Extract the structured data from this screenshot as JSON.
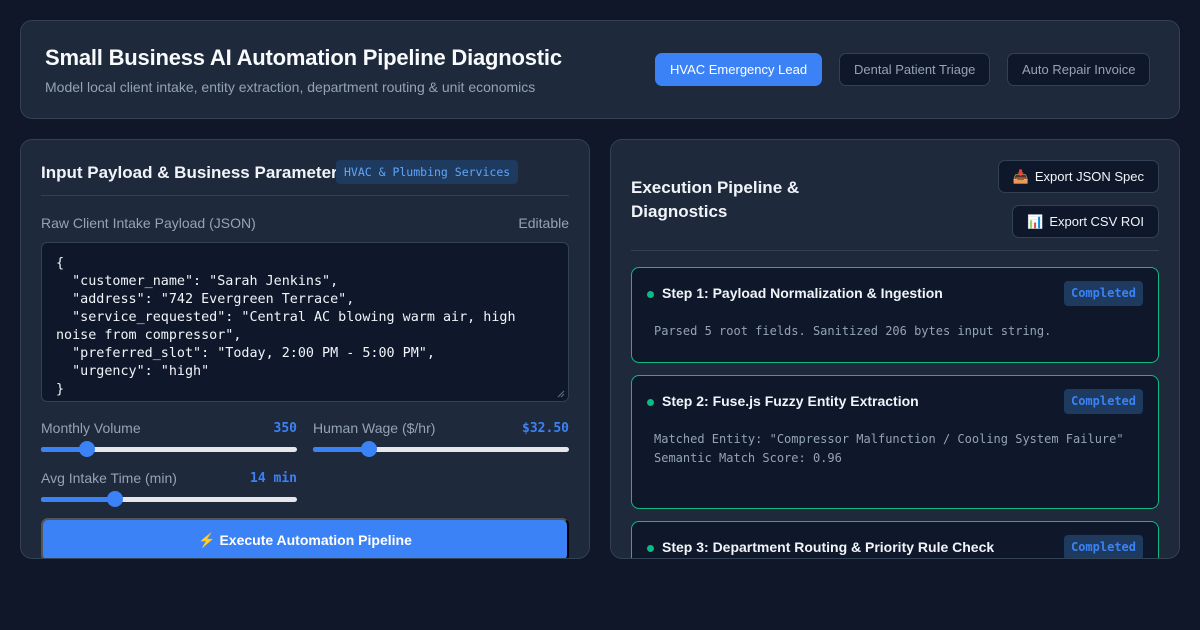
{
  "header": {
    "title": "Small Business AI Automation Pipeline Diagnostic",
    "subtitle": "Model local client intake, entity extraction, department routing & unit economics",
    "scenarios": [
      {
        "label": "HVAC Emergency Lead",
        "active": true
      },
      {
        "label": "Dental Patient Triage",
        "active": false
      },
      {
        "label": "Auto Repair Invoice",
        "active": false
      }
    ]
  },
  "input_panel": {
    "title": "Input Payload & Business Parameters",
    "badge": "HVAC & Plumbing Services",
    "payload_label": "Raw Client Intake Payload (JSON)",
    "editable_label": "Editable",
    "payload": "{\n  \"customer_name\": \"Sarah Jenkins\",\n  \"address\": \"742 Evergreen Terrace\",\n  \"service_requested\": \"Central AC blowing warm air, high noise from compressor\",\n  \"preferred_slot\": \"Today, 2:00 PM - 5:00 PM\",\n  \"urgency\": \"high\"\n}",
    "sliders": {
      "monthly_volume": {
        "label": "Monthly Volume",
        "value": "350",
        "fill_fraction": 0.18
      },
      "human_wage": {
        "label": "Human Wage ($/hr)",
        "value": "$32.50",
        "fill_fraction": 0.22
      },
      "avg_intake_time": {
        "label": "Avg Intake Time (min)",
        "value": "14 min",
        "fill_fraction": 0.29
      }
    },
    "execute_label": "⚡ Execute Automation Pipeline"
  },
  "pipeline_panel": {
    "title": "Execution Pipeline & Diagnostics",
    "export_json": {
      "icon": "📥",
      "label": "Export JSON Spec"
    },
    "export_csv": {
      "icon": "📊",
      "label": "Export CSV ROI"
    },
    "steps": [
      {
        "title": "Step 1: Payload Normalization & Ingestion",
        "status": "Completed",
        "detail": "Parsed 5 root fields. Sanitized 206 bytes input string."
      },
      {
        "title": "Step 2: Fuse.js Fuzzy Entity Extraction",
        "status": "Completed",
        "detail": "Matched Entity: \"Compressor Malfunction / Cooling System Failure\"\nSemantic Match Score: 0.96"
      },
      {
        "title": "Step 3: Department Routing & Priority Rule Check",
        "status": "Completed",
        "detail": ""
      }
    ],
    "status_color": "#10b981",
    "accent_color": "#3b82f6"
  }
}
